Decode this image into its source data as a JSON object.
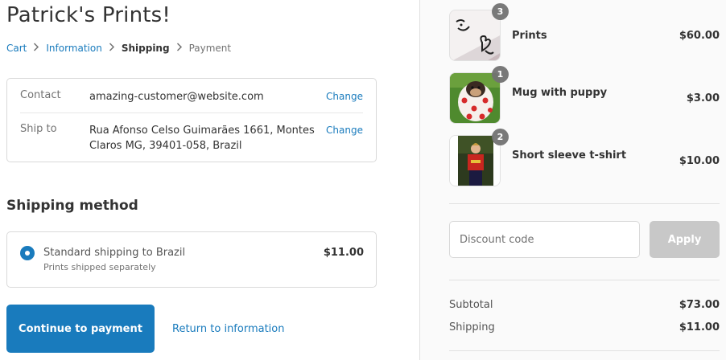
{
  "store": {
    "title": "Patrick's Prints!"
  },
  "breadcrumb": {
    "items": [
      {
        "label": "Cart",
        "state": "link"
      },
      {
        "label": "Information",
        "state": "link"
      },
      {
        "label": "Shipping",
        "state": "current"
      },
      {
        "label": "Payment",
        "state": "upcoming"
      }
    ]
  },
  "review": {
    "contact_label": "Contact",
    "contact_value": "amazing-customer@website.com",
    "ship_label": "Ship to",
    "ship_value": "Rua Afonso Celso Guimarães 1661, Montes Claros MG, 39401-058, Brazil",
    "change_label": "Change"
  },
  "shipping": {
    "section_title": "Shipping method",
    "method_name": "Standard shipping to Brazil",
    "method_note": "Prints shipped separately",
    "method_price": "$11.00"
  },
  "actions": {
    "continue_label": "Continue to payment",
    "return_label": "Return to information"
  },
  "cart": {
    "items": [
      {
        "name": "Prints",
        "price": "$60.00",
        "quantity": "3",
        "image": "prints-photo"
      },
      {
        "name": "Mug with puppy",
        "price": "$3.00",
        "quantity": "1",
        "image": "puppy-mug-photo"
      },
      {
        "name": "Short sleeve t-shirt",
        "price": "$10.00",
        "quantity": "2",
        "image": "tshirt-photo"
      }
    ]
  },
  "discount": {
    "placeholder": "Discount code",
    "apply_label": "Apply"
  },
  "summary": {
    "subtotal_label": "Subtotal",
    "subtotal_value": "$73.00",
    "shipping_label": "Shipping",
    "shipping_value": "$11.00"
  },
  "colors": {
    "accent": "#197bbd",
    "apply_disabled": "#c8c8c8",
    "sidebar_bg": "#fafafa"
  }
}
